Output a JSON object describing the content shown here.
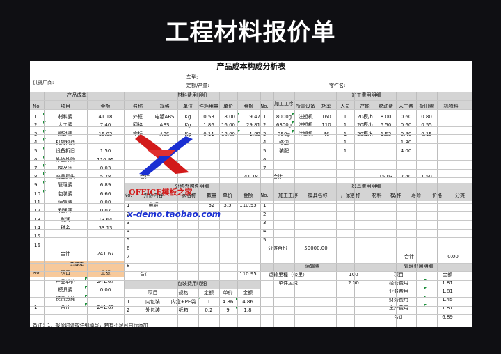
{
  "banner": {
    "title": "工程材料报价单"
  },
  "sheet": {
    "title": "产品成本构成分析表",
    "info": {
      "supplier": "供货厂商:",
      "car_model": "车型:",
      "quota": "定额/产量:",
      "part_name": "零件名:"
    },
    "product_cost": {
      "section": "产品成本",
      "headers": [
        "No.",
        "项目",
        "金额"
      ],
      "rows": [
        [
          "1",
          "材料费",
          "41.18"
        ],
        [
          "2",
          "人工费",
          "7.40"
        ],
        [
          "3",
          "燃动费",
          "15.03"
        ],
        [
          "4",
          "机物料费",
          ""
        ],
        [
          "5",
          "设备折旧",
          "1.50"
        ],
        [
          "6",
          "外协外购",
          "110.95"
        ],
        [
          "7",
          "废品率",
          "0.03"
        ],
        [
          "8",
          "废品损失",
          "5.28"
        ],
        [
          "9",
          "管理费",
          "6.89"
        ],
        [
          "10",
          "包装费",
          "6.66"
        ],
        [
          "11",
          "运输费",
          "0.00"
        ],
        [
          "12",
          "利润率",
          "0.07"
        ],
        [
          "13",
          "利润",
          "13.64"
        ],
        [
          "14",
          "税金",
          "33.13"
        ],
        [
          "15",
          "",
          ""
        ],
        [
          "16",
          "",
          ""
        ]
      ],
      "total_label": "合计",
      "total_value": "241.67"
    },
    "total_cost": {
      "section": "总成本",
      "headers": [
        "No.",
        "项目",
        "金额"
      ],
      "rows": [
        [
          "",
          "产品单价",
          "241.67"
        ],
        [
          "",
          "模具费",
          "0.00"
        ],
        [
          "",
          "模具分摊",
          ""
        ],
        [
          "1",
          "合计",
          "241.67"
        ]
      ]
    },
    "material": {
      "section": "材料费用明细",
      "headers": [
        "名称",
        "规格",
        "单位",
        "件耗用量",
        "单价",
        "金额"
      ],
      "rows": [
        [
          "外框",
          "电镀ABS",
          "Kg",
          "0.53",
          "18.00",
          "9.47"
        ],
        [
          "网格",
          "ABS",
          "Kg",
          "1.86",
          "16.00",
          "29.81"
        ],
        [
          "字标",
          "ABS",
          "Kg",
          "0.11",
          "18.00",
          "1.89"
        ]
      ],
      "total_label": "合计",
      "total_value": "41.18"
    },
    "processing": {
      "section": "加工费用明细",
      "headers": [
        "No.",
        "加工工序",
        "所需设备",
        "功率",
        "人员",
        "产能",
        "燃动费",
        "人工费",
        "折旧费",
        "机物料"
      ],
      "rows": [
        [
          "1",
          "8000g",
          "注塑机",
          "160",
          "1",
          "20模/h",
          "8.00",
          "0.60",
          "0.80",
          ""
        ],
        [
          "2",
          "6300g",
          "注塑机",
          "110",
          "1",
          "20模/h",
          "5.50",
          "0.60",
          "0.55",
          ""
        ],
        [
          "3",
          "750g",
          "注塑机",
          "46",
          "1",
          "30模/h",
          "1.53",
          "0.40",
          "0.15",
          ""
        ],
        [
          "4",
          "修边",
          "",
          "",
          "1",
          "",
          "",
          "1.80",
          "",
          ""
        ],
        [
          "5",
          "装配",
          "",
          "",
          "1",
          "",
          "",
          "4.00",
          "",
          ""
        ],
        [
          "6",
          "",
          "",
          "",
          "",
          "",
          "",
          "",
          "",
          ""
        ],
        [
          "7",
          "",
          "",
          "",
          "",
          "",
          "",
          "",
          "",
          ""
        ]
      ],
      "total_label": "合计",
      "totals": [
        "15.03",
        "7.40",
        "1.50"
      ]
    },
    "outsource": {
      "section": "外协外购件明细",
      "headers": [
        "No.",
        "外协内容",
        "厂家名称",
        "数量",
        "单价",
        "金额"
      ],
      "rows": [
        [
          "1",
          "电镀",
          "",
          "32",
          "3.5",
          "110.95"
        ],
        [
          "2",
          "",
          "",
          "",
          "",
          ""
        ],
        [
          "3",
          "",
          "",
          "",
          "",
          ""
        ],
        [
          "4",
          "",
          "",
          "",
          "",
          ""
        ],
        [
          "5",
          "",
          "",
          "",
          "",
          ""
        ],
        [
          "6",
          "",
          "",
          "",
          "",
          ""
        ],
        [
          "7",
          "",
          "",
          "",
          "",
          ""
        ],
        [
          "8",
          "",
          "",
          "",
          "",
          ""
        ]
      ],
      "total_label": "合计",
      "total_value": "110.95"
    },
    "mold": {
      "section": "模具费用明细",
      "headers": [
        "No.",
        "加工工序",
        "模具名称",
        "厂家名称",
        "材料",
        "模/件",
        "寿命",
        "价格",
        "分摊"
      ],
      "rows": [
        [
          "1"
        ],
        [
          "2"
        ],
        [
          "3"
        ],
        [
          "4"
        ],
        [
          "5"
        ]
      ],
      "share_label": "分摊台份",
      "share_value": "50000.00",
      "total_label": "合计",
      "total_value": "0.00"
    },
    "packaging": {
      "section": "包装费用明细",
      "headers": [
        "项目",
        "规格",
        "定额",
        "单价",
        "金额"
      ],
      "rows": [
        [
          "1",
          "内包装",
          "内盒+PE袋",
          "1",
          "4.86",
          "4.86"
        ],
        [
          "2",
          "外包装",
          "纸箱",
          "0.2",
          "9",
          "1.8"
        ]
      ]
    },
    "transport": {
      "section": "运输费",
      "distance_label": "运输里程（公里）",
      "distance_value": "100",
      "unit_label": "单件运费",
      "unit_value": "2.00"
    },
    "management": {
      "section": "管理费用明细",
      "headers": [
        "项目",
        "金额"
      ],
      "rows": [
        [
          "经营费用",
          "1.81"
        ],
        [
          "业务费用",
          "1.81"
        ],
        [
          "财务费用",
          "1.45"
        ],
        [
          "生产费用",
          "1.81"
        ]
      ],
      "total_label": "合计",
      "total_value": "6.89"
    },
    "note": "备注：1、报价时请按详细填写，若有不足可自行添加"
  },
  "watermark": {
    "brand": "OFFICE模板之家",
    "url": "x-demo.taobao.com"
  },
  "colors": {
    "header_gray": "#d4d4d4",
    "orange": "#f7c99b",
    "logo_red": "#d21a1a",
    "logo_blue": "#1a2fd2"
  }
}
